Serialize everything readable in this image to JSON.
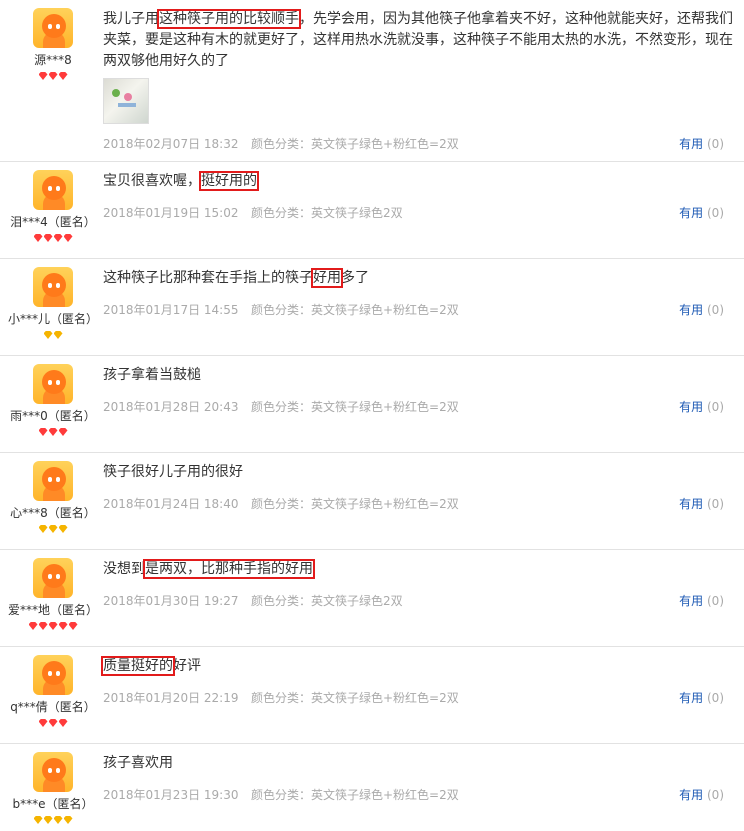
{
  "useful_label": "有用",
  "reviews": [
    {
      "user": "源***8",
      "badge_color": "red",
      "badge_count": 3,
      "segments": [
        {
          "t": "我儿子用",
          "hl": false
        },
        {
          "t": "这种筷子用的比较顺手",
          "hl": true
        },
        {
          "t": "，先学会用，因为其他筷子他拿着夹不好，这种他就能夹好，还帮我们夹菜，要是这种有木的就更好了，这样用热水洗就没事，这种筷子不能用太热的水洗，不然变形，现在两双够他用好久的了",
          "hl": false
        }
      ],
      "has_photo": true,
      "date": "2018年02月07日 18:32",
      "variant": "颜色分类：英文筷子绿色+粉红色=2双",
      "count": "(0)"
    },
    {
      "user": "泪***4（匿名）",
      "badge_color": "red",
      "badge_count": 4,
      "segments": [
        {
          "t": "宝贝很喜欢喔，",
          "hl": false
        },
        {
          "t": "挺好用的",
          "hl": true
        }
      ],
      "has_photo": false,
      "date": "2018年01月19日 15:02",
      "variant": "颜色分类：英文筷子绿色2双",
      "count": "(0)"
    },
    {
      "user": "小***儿（匿名）",
      "badge_color": "gold",
      "badge_count": 2,
      "segments": [
        {
          "t": "这种筷子比那种套在手指上的筷子",
          "hl": false
        },
        {
          "t": "好用",
          "hl": true
        },
        {
          "t": "多了",
          "hl": false
        }
      ],
      "has_photo": false,
      "date": "2018年01月17日 14:55",
      "variant": "颜色分类：英文筷子绿色+粉红色=2双",
      "count": "(0)"
    },
    {
      "user": "雨***0（匿名）",
      "badge_color": "red",
      "badge_count": 3,
      "segments": [
        {
          "t": "孩子拿着当鼓槌",
          "hl": false
        }
      ],
      "has_photo": false,
      "date": "2018年01月28日 20:43",
      "variant": "颜色分类：英文筷子绿色+粉红色=2双",
      "count": "(0)"
    },
    {
      "user": "心***8（匿名）",
      "badge_color": "gold",
      "badge_count": 3,
      "segments": [
        {
          "t": "筷子很好儿子用的很好",
          "hl": false
        }
      ],
      "has_photo": false,
      "date": "2018年01月24日 18:40",
      "variant": "颜色分类：英文筷子绿色+粉红色=2双",
      "count": "(0)"
    },
    {
      "user": "爱***地（匿名）",
      "badge_color": "red",
      "badge_count": 5,
      "segments": [
        {
          "t": "没想到",
          "hl": false
        },
        {
          "t": "是两双，比那种手指的好用",
          "hl": true
        }
      ],
      "has_photo": false,
      "date": "2018年01月30日 19:27",
      "variant": "颜色分类：英文筷子绿色2双",
      "count": "(0)"
    },
    {
      "user": "q***倩（匿名）",
      "badge_color": "red",
      "badge_count": 3,
      "segments": [
        {
          "t": "质量挺好的",
          "hl": true
        },
        {
          "t": "好评",
          "hl": false
        }
      ],
      "has_photo": false,
      "date": "2018年01月20日 22:19",
      "variant": "颜色分类：英文筷子绿色+粉红色=2双",
      "count": "(0)"
    },
    {
      "user": "b***e（匿名）",
      "badge_color": "gold",
      "badge_count": 4,
      "segments": [
        {
          "t": "孩子喜欢用",
          "hl": false
        }
      ],
      "has_photo": false,
      "date": "2018年01月23日 19:30",
      "variant": "颜色分类：英文筷子绿色+粉红色=2双",
      "count": "(0)"
    }
  ]
}
